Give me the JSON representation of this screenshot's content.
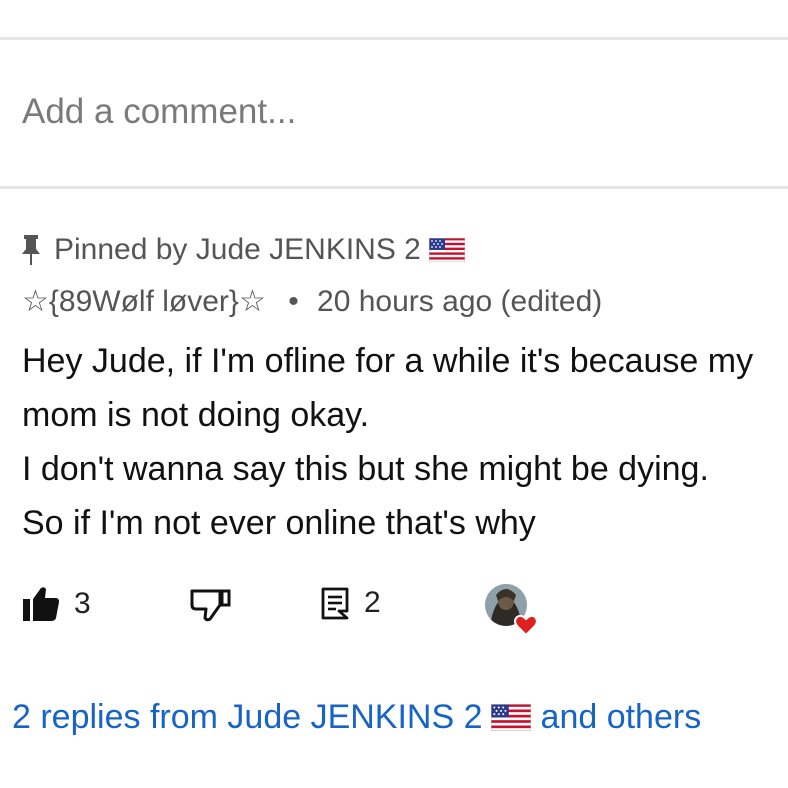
{
  "composer": {
    "placeholder": "Add a comment..."
  },
  "comment": {
    "pinned_label": "Pinned by Jude JENKINS 2",
    "author": "☆{89Wølf løver}☆",
    "separator": "•",
    "meta": "20 hours ago (edited)",
    "body_lines": [
      "Hey Jude, if I'm ofline for a while it's because my",
      "mom is not doing okay.",
      "I don't wanna say this but she might be dying.",
      "So if I'm not ever online that's why"
    ],
    "likes": "3",
    "reply_count": "2"
  },
  "replies": {
    "label_before": "2 replies from Jude JENKINS 2",
    "label_after": "and others"
  },
  "colors": {
    "link": "#1764c6",
    "meta_text": "#555555",
    "placeholder": "#7a7a7a",
    "heart": "#e0201f"
  },
  "icons": [
    "pin-icon",
    "us-flag-icon",
    "thumbs-up-filled-icon",
    "thumbs-down-outline-icon",
    "reply-comment-icon",
    "creator-heart-icon"
  ]
}
